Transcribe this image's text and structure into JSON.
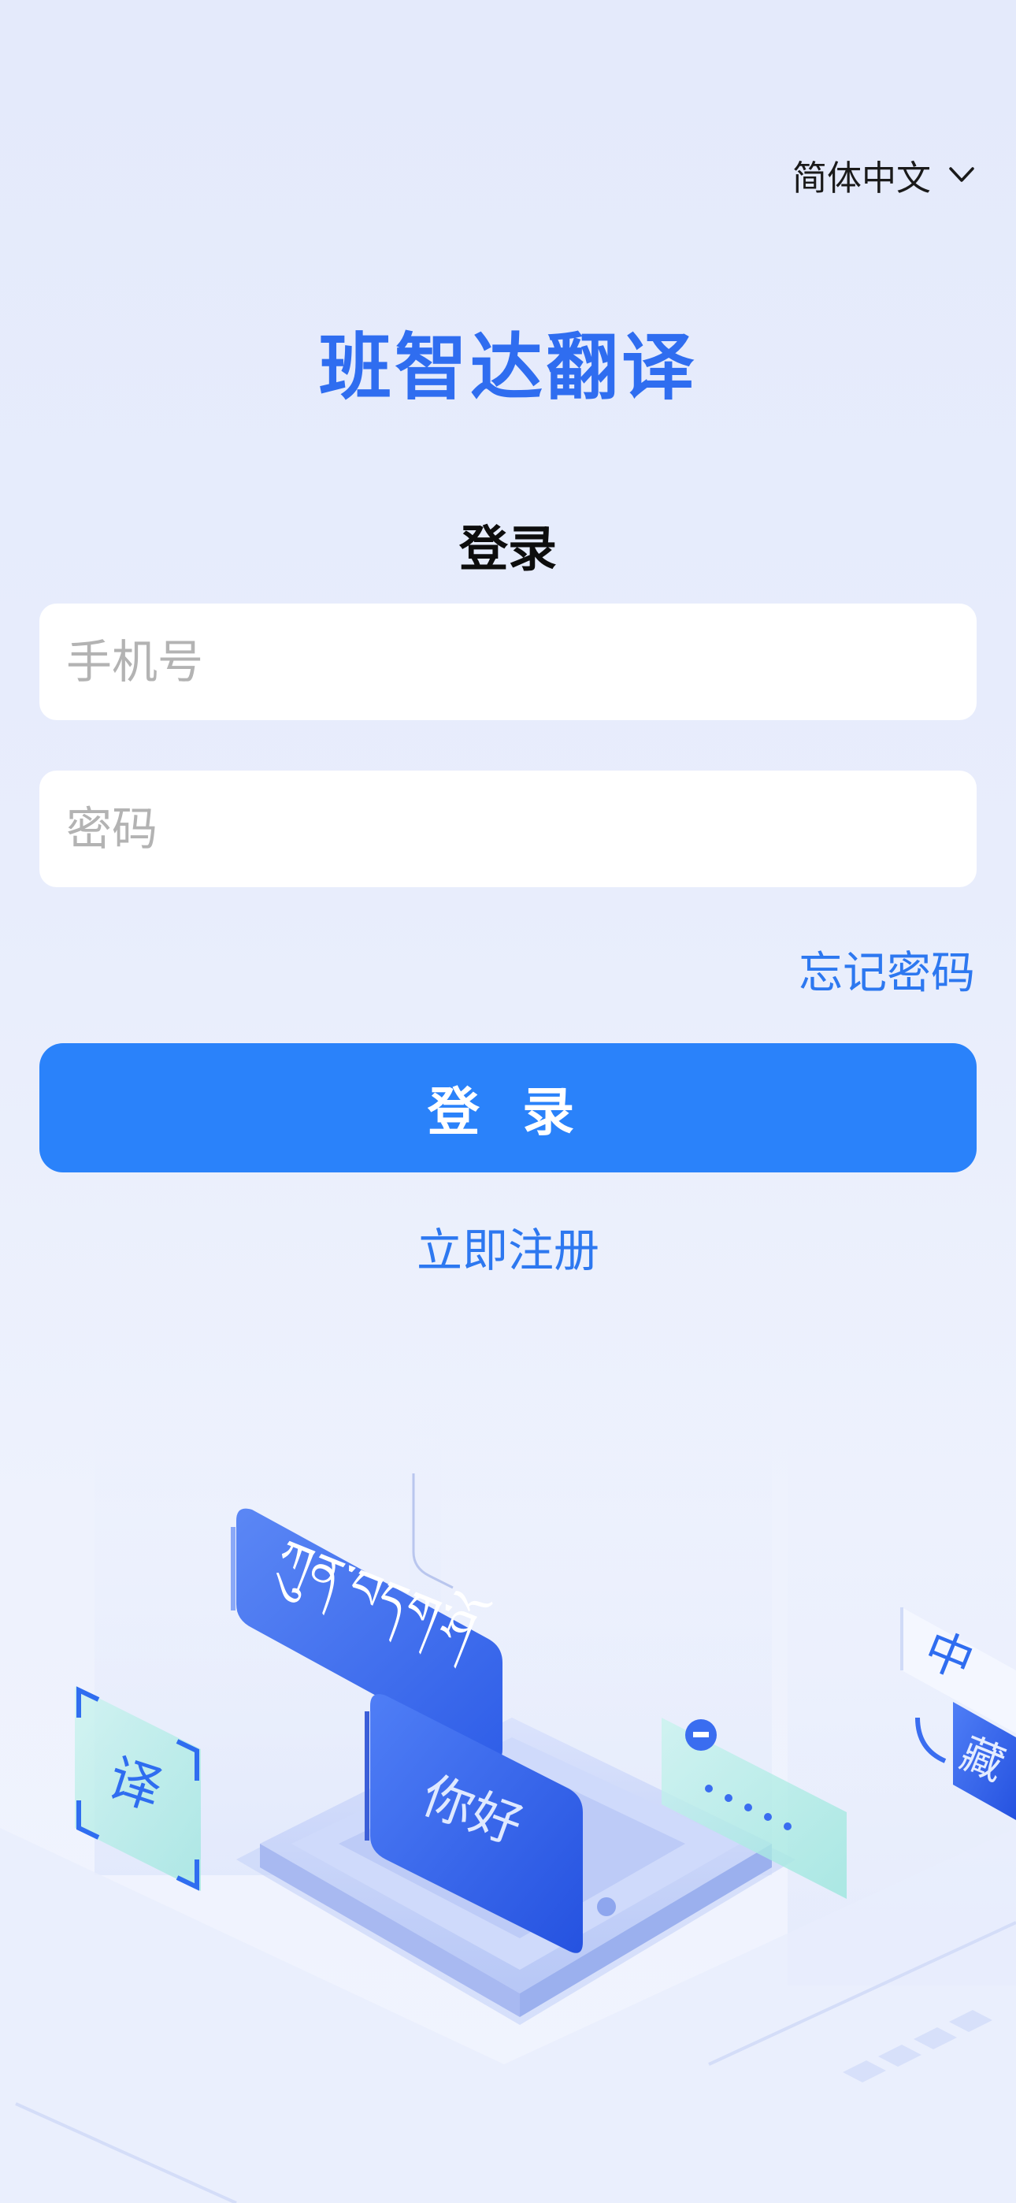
{
  "header": {
    "language": "简体中文"
  },
  "app": {
    "title": "班智达翻译"
  },
  "login": {
    "heading": "登录",
    "phone_placeholder": "手机号",
    "password_placeholder": "密码",
    "forgot_password": "忘记密码",
    "submit_label": "登 录",
    "register_link": "立即注册"
  },
  "illustration": {
    "card_tibetan": "ཀུན་བདག་ཤོ",
    "card_hello": "你好",
    "card_translate": "译",
    "card_zh": "中",
    "card_tibet": "藏"
  },
  "colors": {
    "brand_blue": "#2f6df0",
    "button_blue": "#2a82fa",
    "link_blue": "#2d78f0",
    "background": "#e6ecfb"
  }
}
